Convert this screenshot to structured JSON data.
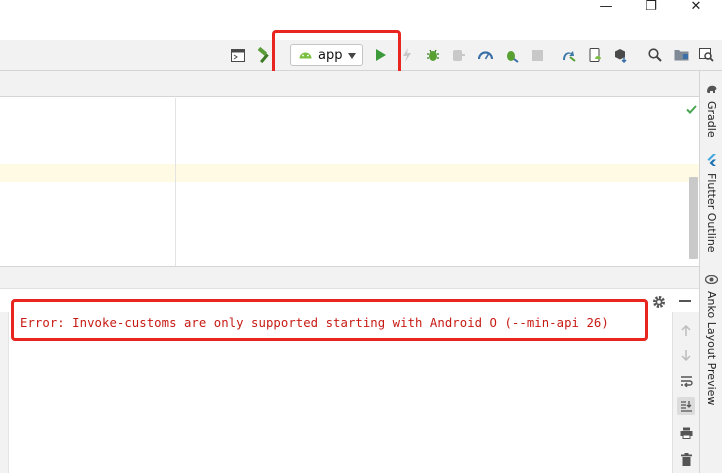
{
  "window": {
    "minimize_glyph": "—",
    "maximize_glyph": "❐",
    "close_glyph": "✕"
  },
  "toolbar": {
    "run_config": "app",
    "icons": [
      "project-structure-icon",
      "build-hammer-icon",
      "android-icon",
      "run-icon",
      "apply-changes-icon",
      "debug-icon",
      "attach-debugger-icon",
      "profile-icon",
      "debug-bug-icon",
      "stop-icon",
      "sync-gradle-icon",
      "avd-manager-icon",
      "sdk-manager-icon",
      "search-icon",
      "project-folder-icon",
      "layout-inspector-icon"
    ]
  },
  "right_tools": {
    "gradle": "Gradle",
    "flutter_outline": "Flutter Outline",
    "anko_preview": "Anko Layout Preview"
  },
  "console": {
    "error_text": "Error: Invoke-customs are only supported starting with Android O (--min-api 26)"
  },
  "colors": {
    "highlight": "#e8261f",
    "error_text": "#c81a13",
    "run_green": "#3c9a3a",
    "android_green": "#7cc043"
  }
}
